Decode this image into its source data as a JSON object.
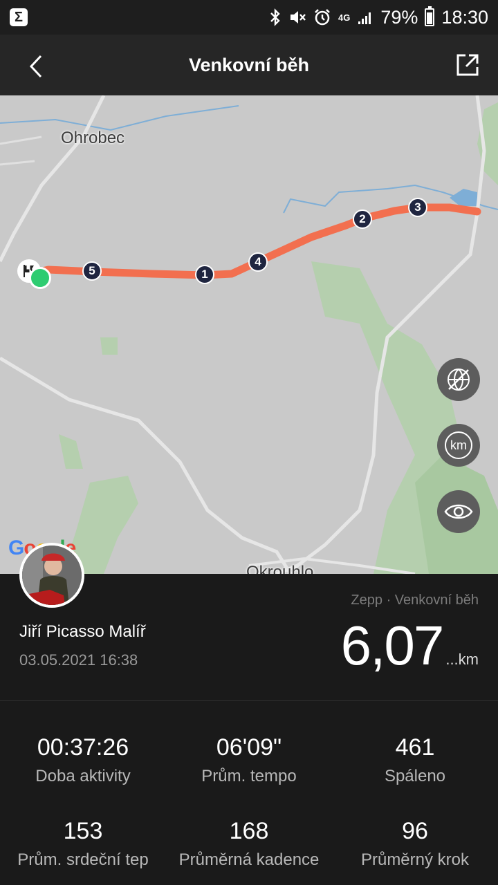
{
  "status_bar": {
    "battery_percent": "79%",
    "time": "18:30",
    "network_label": "4G",
    "battery_level": 0.79,
    "icons": [
      "bluetooth-icon",
      "mute-icon",
      "alarm-icon",
      "signal-icon",
      "battery-icon"
    ]
  },
  "header": {
    "title": "Venkovní běh"
  },
  "map": {
    "labels": {
      "top_town": "Ohrobec",
      "bottom_town": "Okrouhlo"
    },
    "km_markers": [
      "1",
      "2",
      "3",
      "4",
      "5"
    ],
    "google_logo": "Google",
    "route_color": "#f26f4f",
    "controls": {
      "km_label": "km"
    }
  },
  "summary": {
    "user_name": "Jiří Picasso Malíř",
    "date": "03.05.2021 16:38",
    "source": "Zepp · Venkovní běh",
    "distance": "6,07",
    "distance_unit": "...km"
  },
  "stats": [
    {
      "value": "00:37:26",
      "label": "Doba aktivity"
    },
    {
      "value": "06'09\"",
      "label": "Prům. tempo"
    },
    {
      "value": "461",
      "label": "Spáleno"
    },
    {
      "value": "153",
      "label": "Prům. srdeční tep"
    },
    {
      "value": "168",
      "label": "Průměrná kadence"
    },
    {
      "value": "96",
      "label": "Průměrný krok"
    }
  ]
}
